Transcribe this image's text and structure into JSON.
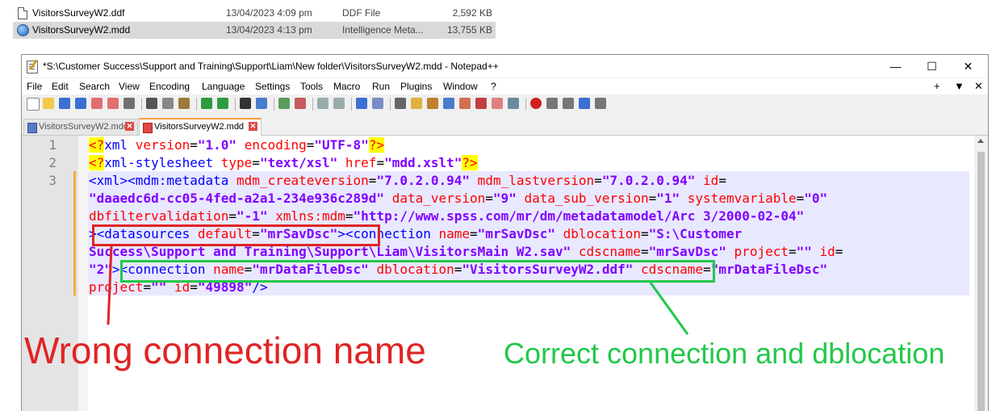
{
  "explorer": {
    "files": [
      {
        "name": "VisitorsSurveyW2.ddf",
        "date": "13/04/2023 4:09 pm",
        "type": "DDF File",
        "size": "2,592 KB",
        "icon": "document-icon"
      },
      {
        "name": "VisitorsSurveyW2.mdd",
        "date": "13/04/2023 4:13 pm",
        "type": "Intelligence Meta...",
        "size": "13,755 KB",
        "icon": "globe-icon"
      }
    ]
  },
  "window": {
    "title": "*S:\\Customer Success\\Support and Training\\Support\\Liam\\New folder\\VisitorsSurveyW2.mdd - Notepad++",
    "minimize": "—",
    "maximize": "☐",
    "close": "✕"
  },
  "menu": {
    "items": [
      "File",
      "Edit",
      "Search",
      "View",
      "Encoding",
      "Language",
      "Settings",
      "Tools",
      "Macro",
      "Run",
      "Plugins",
      "Window",
      "?"
    ],
    "right": [
      "+",
      "▼",
      "✕"
    ]
  },
  "tabs": [
    {
      "label": "VisitorsSurveyW2.mdd",
      "active": false,
      "close": "✕"
    },
    {
      "label": "VisitorsSurveyW2.mdd",
      "active": true,
      "close": "✕"
    }
  ],
  "editor": {
    "line_numbers": [
      "1",
      "2",
      "3"
    ],
    "lines": [
      [
        [
          "br",
          "<?"
        ],
        [
          "tg",
          "xml "
        ],
        [
          "at",
          "version"
        ],
        [
          "eq",
          "="
        ],
        [
          "vl",
          "\"1.0\""
        ],
        [
          "tx",
          " "
        ],
        [
          "at",
          "encoding"
        ],
        [
          "eq",
          "="
        ],
        [
          "vl",
          "\"UTF-8\""
        ],
        [
          "br",
          "?>"
        ]
      ],
      [
        [
          "br",
          "<?"
        ],
        [
          "tg",
          "xml-stylesheet "
        ],
        [
          "at",
          "type"
        ],
        [
          "eq",
          "="
        ],
        [
          "vl",
          "\"text/xsl\""
        ],
        [
          "tx",
          " "
        ],
        [
          "at",
          "href"
        ],
        [
          "eq",
          "="
        ],
        [
          "vl",
          "\"mdd.xslt\""
        ],
        [
          "br",
          "?>"
        ]
      ],
      [
        [
          "tg",
          "<xml><mdm:metadata "
        ],
        [
          "at",
          "mdm_createversion"
        ],
        [
          "eq",
          "="
        ],
        [
          "vl",
          "\"7.0.2.0.94\""
        ],
        [
          "tx",
          " "
        ],
        [
          "at",
          "mdm_lastversion"
        ],
        [
          "eq",
          "="
        ],
        [
          "vl",
          "\"7.0.2.0.94\""
        ],
        [
          "tx",
          " "
        ],
        [
          "at",
          "id"
        ],
        [
          "eq",
          "="
        ]
      ],
      [
        [
          "vl",
          "\"daaedc6d-cc05-4fed-a2a1-234e936c289d\""
        ],
        [
          "tx",
          " "
        ],
        [
          "at",
          "data_version"
        ],
        [
          "eq",
          "="
        ],
        [
          "vl",
          "\"9\""
        ],
        [
          "tx",
          " "
        ],
        [
          "at",
          "data_sub_version"
        ],
        [
          "eq",
          "="
        ],
        [
          "vl",
          "\"1\""
        ],
        [
          "tx",
          " "
        ],
        [
          "at",
          "systemvariable"
        ],
        [
          "eq",
          "="
        ],
        [
          "vl",
          "\"0\""
        ]
      ],
      [
        [
          "at",
          "dbfiltervalidation"
        ],
        [
          "eq",
          "="
        ],
        [
          "vl",
          "\"-1\""
        ],
        [
          "tx",
          " "
        ],
        [
          "at",
          "xmlns:mdm"
        ],
        [
          "eq",
          "="
        ],
        [
          "vl",
          "\"http://www.spss.com/mr/dm/metadatamodel/Arc 3/2000-02-04\""
        ]
      ],
      [
        [
          "tg",
          "><datasources "
        ],
        [
          "at",
          "default"
        ],
        [
          "eq",
          "="
        ],
        [
          "vl",
          "\"mrSavDsc\""
        ],
        [
          "tg",
          "><connection "
        ],
        [
          "at",
          "name"
        ],
        [
          "eq",
          "="
        ],
        [
          "vl",
          "\"mrSavDsc\""
        ],
        [
          "tx",
          " "
        ],
        [
          "at",
          "dblocation"
        ],
        [
          "eq",
          "="
        ],
        [
          "vl",
          "\"S:\\Customer"
        ]
      ],
      [
        [
          "vl",
          "Success\\Support and Training\\Support\\Liam\\VisitorsMain W2.sav\""
        ],
        [
          "tx",
          " "
        ],
        [
          "at",
          "cdscname"
        ],
        [
          "eq",
          "="
        ],
        [
          "vl",
          "\"mrSavDsc\""
        ],
        [
          "tx",
          " "
        ],
        [
          "at",
          "project"
        ],
        [
          "eq",
          "="
        ],
        [
          "vl",
          "\"\""
        ],
        [
          "tx",
          " "
        ],
        [
          "at",
          "id"
        ],
        [
          "eq",
          "="
        ]
      ],
      [
        [
          "vl",
          "\"2\""
        ],
        [
          "tg",
          "><connection "
        ],
        [
          "at",
          "name"
        ],
        [
          "eq",
          "="
        ],
        [
          "vl",
          "\"mrDataFileDsc\""
        ],
        [
          "tx",
          " "
        ],
        [
          "at",
          "dblocation"
        ],
        [
          "eq",
          "="
        ],
        [
          "vl",
          "\"VisitorsSurveyW2.ddf\""
        ],
        [
          "tx",
          " "
        ],
        [
          "at",
          "cdscname"
        ],
        [
          "eq",
          "="
        ],
        [
          "vl",
          "\"mrDataFileDsc\""
        ]
      ],
      [
        [
          "at",
          "project"
        ],
        [
          "eq",
          "="
        ],
        [
          "vl",
          "\"\""
        ],
        [
          "tx",
          " "
        ],
        [
          "at",
          "id"
        ],
        [
          "eq",
          "="
        ],
        [
          "vl",
          "\"49898\""
        ],
        [
          "tg",
          "/>"
        ]
      ]
    ]
  },
  "annotations": {
    "wrong": "Wrong connection name",
    "correct": "Correct connection and dblocation",
    "colors": {
      "red": "#e02424",
      "green": "#22c84a"
    }
  }
}
